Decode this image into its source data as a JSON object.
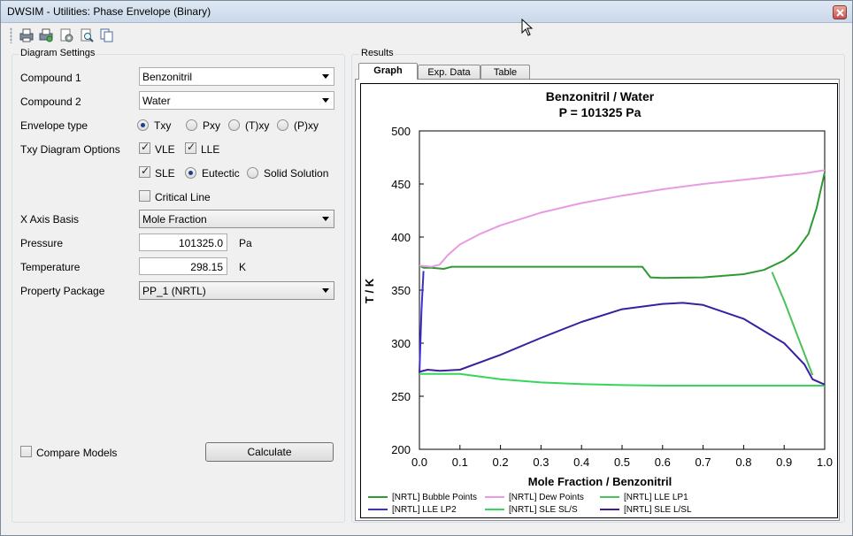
{
  "window": {
    "title": "DWSIM - Utilities: Phase Envelope (Binary)"
  },
  "toolbar": {
    "buttons": [
      "print-icon",
      "print-preview-icon",
      "page-setup-icon",
      "zoom-preview-icon",
      "copy-icon"
    ]
  },
  "settings": {
    "group_title": "Diagram Settings",
    "compound1_label": "Compound 1",
    "compound1_value": "Benzonitril",
    "compound2_label": "Compound 2",
    "compound2_value": "Water",
    "envelope_label": "Envelope type",
    "envelope_options": [
      "Txy",
      "Pxy",
      "(T)xy",
      "(P)xy"
    ],
    "envelope_selected": "Txy",
    "txy_label": "Txy Diagram Options",
    "vle_label": "VLE",
    "lle_label": "LLE",
    "sle_label": "SLE",
    "eutectic_label": "Eutectic",
    "solid_solution_label": "Solid Solution",
    "critical_line_label": "Critical Line",
    "xaxis_label": "X Axis Basis",
    "xaxis_value": "Mole Fraction",
    "pressure_label": "Pressure",
    "pressure_value": "101325.0",
    "pressure_unit": "Pa",
    "temperature_label": "Temperature",
    "temperature_value": "298.15",
    "temperature_unit": "K",
    "pp_label": "Property Package",
    "pp_value": "PP_1 (NRTL)",
    "compare_label": "Compare Models",
    "calculate_label": "Calculate"
  },
  "results": {
    "group_title": "Results",
    "tabs": [
      "Graph",
      "Exp. Data",
      "Table"
    ],
    "active_tab": "Graph"
  },
  "chart_data": {
    "type": "line",
    "title": "Benzonitril / Water",
    "subtitle": "P = 101325 Pa",
    "xlabel": "Mole Fraction / Benzonitril",
    "ylabel": "T / K",
    "xlim": [
      0.0,
      1.0
    ],
    "ylim": [
      200,
      500
    ],
    "xticks": [
      "0.0",
      "0.1",
      "0.2",
      "0.3",
      "0.4",
      "0.5",
      "0.6",
      "0.7",
      "0.8",
      "0.9",
      "1.0"
    ],
    "yticks": [
      "200",
      "250",
      "300",
      "350",
      "400",
      "450",
      "500"
    ],
    "grid": false,
    "legend_position": "bottom",
    "series": [
      {
        "name": "[NRTL] Bubble Points",
        "color": "#2e9a33",
        "x": [
          0.0,
          0.01,
          0.03,
          0.06,
          0.08,
          0.1,
          0.2,
          0.3,
          0.4,
          0.5,
          0.55,
          0.57,
          0.6,
          0.7,
          0.8,
          0.85,
          0.9,
          0.93,
          0.96,
          0.98,
          1.0
        ],
        "y": [
          373,
          371,
          371,
          370,
          372,
          372,
          372,
          372,
          372,
          372,
          372,
          362,
          361.5,
          362,
          365,
          369,
          378,
          387,
          403,
          427,
          461
        ]
      },
      {
        "name": "[NRTL] Dew Points",
        "color": "#e89be3",
        "x": [
          0.0,
          0.03,
          0.05,
          0.07,
          0.1,
          0.15,
          0.2,
          0.3,
          0.4,
          0.5,
          0.6,
          0.7,
          0.8,
          0.9,
          0.95,
          1.0
        ],
        "y": [
          373,
          372,
          374,
          383,
          393,
          403,
          411,
          423,
          432,
          439,
          445,
          450,
          454,
          458,
          460,
          463
        ]
      },
      {
        "name": "[NRTL] LLE LP1",
        "color": "#4cc05a",
        "x": [
          0.87,
          0.9,
          0.93,
          0.95,
          0.97
        ],
        "y": [
          367,
          340,
          310,
          290,
          270
        ]
      },
      {
        "name": "[NRTL] LLE LP2",
        "color": "#3a2fd0",
        "x": [
          0.0,
          0.005,
          0.01
        ],
        "y": [
          272,
          330,
          368
        ]
      },
      {
        "name": "[NRTL] SLE SL/S",
        "color": "#37d65a",
        "x": [
          0.0,
          0.05,
          0.1,
          0.2,
          0.3,
          0.4,
          0.5,
          0.6,
          0.7,
          0.8,
          0.9,
          1.0
        ],
        "y": [
          271,
          271,
          271,
          266,
          263,
          261.5,
          260.5,
          260,
          260,
          260,
          260,
          260
        ]
      },
      {
        "name": "[NRTL] SLE L/SL",
        "color": "#3a1fa0",
        "x": [
          0.0,
          0.02,
          0.05,
          0.1,
          0.2,
          0.3,
          0.4,
          0.5,
          0.6,
          0.65,
          0.7,
          0.8,
          0.9,
          0.95,
          0.97,
          1.0
        ],
        "y": [
          273,
          275,
          274,
          275,
          289,
          305,
          320,
          332,
          337,
          338,
          336,
          323,
          300,
          280,
          266,
          261
        ]
      }
    ]
  }
}
